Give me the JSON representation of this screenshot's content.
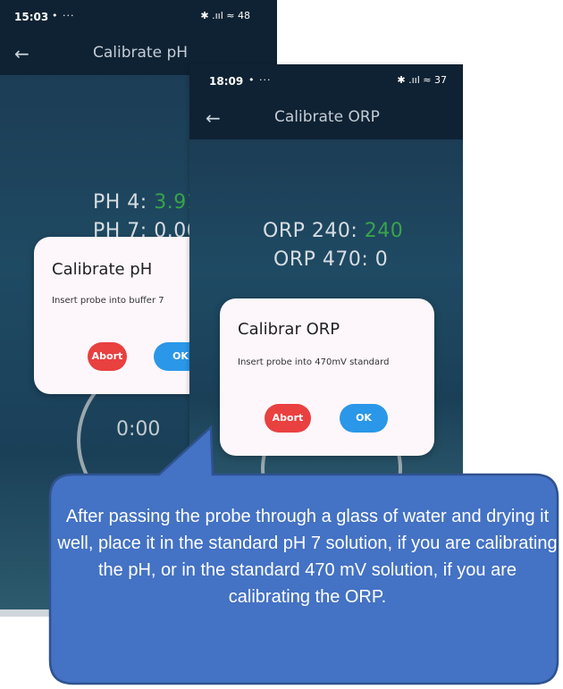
{
  "phone_left": {
    "status": {
      "time": "15:03",
      "notif": "• ···",
      "icons": "✱ .ııl ≈ 48"
    },
    "appbar": {
      "back": "←",
      "title": "Calibrate pH"
    },
    "readings": {
      "ph4_label": "PH 4: ",
      "ph4_value": "3.91",
      "ph7_label": "PH 7: ",
      "ph7_value": "0.00"
    },
    "timer": "0:00",
    "dialog": {
      "title": "Calibrate pH",
      "message": "Insert probe into buffer 7",
      "abort": "Abort",
      "ok": "OK"
    }
  },
  "phone_right": {
    "status": {
      "time": "18:09",
      "notif": "• ···",
      "icons": "✱ .ııl ≈ 37"
    },
    "appbar": {
      "back": "←",
      "title": "Calibrate ORP"
    },
    "readings": {
      "orp240_label": "ORP 240: ",
      "orp240_value": "240",
      "orp470_label": "ORP 470: ",
      "orp470_value": "0"
    },
    "dialog": {
      "title": "Calibrar ORP",
      "message": "Insert probe into 470mV standard",
      "abort": "Abort",
      "ok": "OK"
    }
  },
  "callout": {
    "text": "After passing the probe through a glass of water and drying it well, place it in the standard pH 7 solution, if you are calibrating the pH, or in the standard 470 mV solution, if you are calibrating the ORP."
  },
  "colors": {
    "callout_fill": "#4472c4",
    "callout_border": "#2f528f",
    "value_green": "#39a34a",
    "abort_red": "#e94040",
    "ok_blue": "#2a97e8"
  }
}
